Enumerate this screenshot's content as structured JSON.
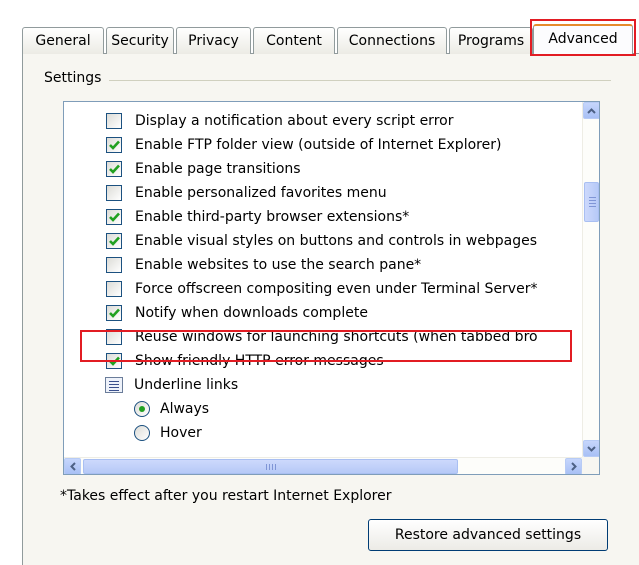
{
  "tabs": [
    {
      "label": "General"
    },
    {
      "label": "Security"
    },
    {
      "label": "Privacy"
    },
    {
      "label": "Content"
    },
    {
      "label": "Connections"
    },
    {
      "label": "Programs"
    },
    {
      "label": "Advanced"
    }
  ],
  "settings_group": {
    "label": "Settings"
  },
  "items": [
    {
      "label": "Display a notification about every script error",
      "type": "checkbox",
      "checked": false
    },
    {
      "label": "Enable FTP folder view (outside of Internet Explorer)",
      "type": "checkbox",
      "checked": true
    },
    {
      "label": "Enable page transitions",
      "type": "checkbox",
      "checked": true
    },
    {
      "label": "Enable personalized favorites menu",
      "type": "checkbox",
      "checked": false
    },
    {
      "label": "Enable third-party browser extensions*",
      "type": "checkbox",
      "checked": true
    },
    {
      "label": "Enable visual styles on buttons and controls in webpages",
      "type": "checkbox",
      "checked": true
    },
    {
      "label": "Enable websites to use the search pane*",
      "type": "checkbox",
      "checked": false
    },
    {
      "label": "Force offscreen compositing even under Terminal Server*",
      "type": "checkbox",
      "checked": false
    },
    {
      "label": "Notify when downloads complete",
      "type": "checkbox",
      "checked": true
    },
    {
      "label": "Reuse windows for launching shortcuts (when tabbed bro",
      "type": "checkbox",
      "checked": false
    },
    {
      "label": "Show friendly HTTP error messages",
      "type": "checkbox",
      "checked": true
    },
    {
      "label": "Underline links",
      "type": "group"
    },
    {
      "label": "Always",
      "type": "radio",
      "checked": true
    },
    {
      "label": "Hover",
      "type": "radio",
      "checked": false
    }
  ],
  "footnote": "*Takes effect after you restart Internet Explorer",
  "restore_button": "Restore advanced settings",
  "colors": {
    "highlight": "#e21c23",
    "check": "#21a121",
    "active_tab_accent": "#e68b2c"
  },
  "scrollbar": {
    "vertical_thumb_position": 0.22
  }
}
